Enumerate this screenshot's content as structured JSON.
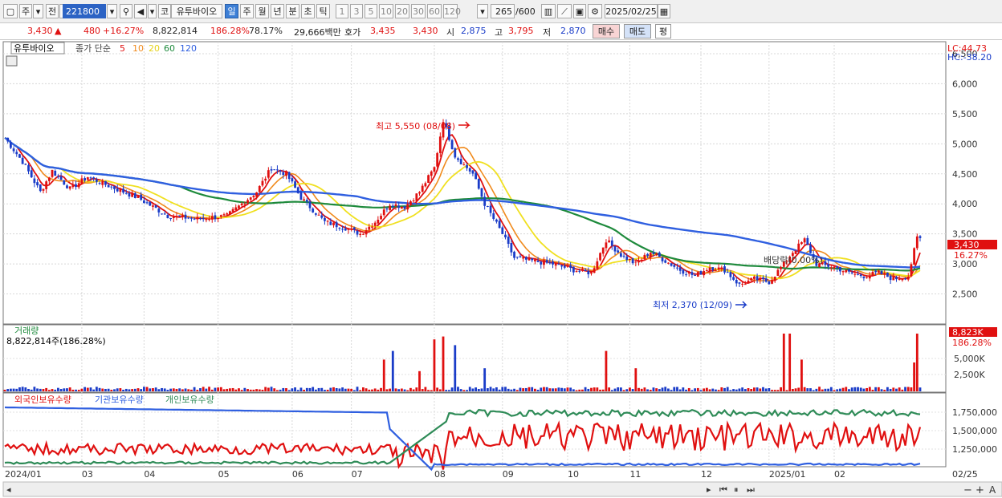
{
  "toolbar": {
    "period_week": "주",
    "prev_label": "전",
    "code": "221800",
    "stock_name_short": "유투바이오",
    "stock_prefix": "코",
    "periods": [
      "일",
      "주",
      "월",
      "년",
      "분",
      "초",
      "틱"
    ],
    "active_period": "일",
    "intervals": [
      "1",
      "3",
      "5",
      "10",
      "20",
      "30",
      "60",
      "120"
    ],
    "count": "265",
    "count_max": "/600",
    "date": "2025/02/25"
  },
  "quote": {
    "price": "3,430",
    "change": "480",
    "change_pct": "+16.27%",
    "volume": "8,822,814",
    "volume_ratio": "186.28%",
    "turnover_rate": "78.17%",
    "amount": "29,666백만",
    "bid_label": "호가",
    "bid": "3,435",
    "ask": "3,430",
    "open_label": "시",
    "open": "2,875",
    "high_label": "고",
    "high": "3,795",
    "low_label": "저",
    "low": "2,870",
    "buy_label": "매수",
    "sell_label": "매도",
    "eval_label": "평"
  },
  "colors": {
    "up": "#e01010",
    "down": "#1a3cc8",
    "ma5": "#e01010",
    "ma10": "#f08a1c",
    "ma20": "#f0e020",
    "ma60": "#1e8a3c",
    "ma120": "#2f5fe0",
    "foreign": "#e01010",
    "institution": "#2f5fe0",
    "individual": "#2e8b57"
  },
  "chart_data": [
    {
      "type": "candlestick",
      "title": "유투바이오",
      "legend": [
        "종가 단순",
        "5",
        "10",
        "20",
        "60",
        "120"
      ],
      "price_axis": [
        "6,500",
        "6,000",
        "5,500",
        "5,000",
        "4,500",
        "4,000",
        "3,500",
        "3,000",
        "2,500"
      ],
      "ylim": [
        2000,
        6700
      ],
      "lc": "LC:44.73",
      "hc": "HC:-38.20",
      "last_price": "3,430",
      "last_pct": "16.27%",
      "annotations": {
        "high": "최고 5,550 (08/08)",
        "low": "최저 2,370 (12/09)",
        "dividend": "배당락(0.00%)"
      },
      "x_labels": [
        "2024/01",
        "03",
        "04",
        "05",
        "06",
        "07",
        "08",
        "09",
        "10",
        "11",
        "12",
        "2025/01",
        "02",
        "02/25"
      ],
      "close_anchors": [
        [
          0,
          5100
        ],
        [
          6,
          4700
        ],
        [
          12,
          4200
        ],
        [
          16,
          4550
        ],
        [
          22,
          4250
        ],
        [
          28,
          4450
        ],
        [
          35,
          4300
        ],
        [
          45,
          4100
        ],
        [
          55,
          3800
        ],
        [
          65,
          3750
        ],
        [
          75,
          3800
        ],
        [
          85,
          4200
        ],
        [
          90,
          4600
        ],
        [
          95,
          4500
        ],
        [
          100,
          4100
        ],
        [
          108,
          3700
        ],
        [
          115,
          3600
        ],
        [
          120,
          3500
        ],
        [
          125,
          3700
        ],
        [
          130,
          4000
        ],
        [
          135,
          3950
        ],
        [
          140,
          4200
        ],
        [
          145,
          4600
        ],
        [
          148,
          5400
        ],
        [
          152,
          4800
        ],
        [
          158,
          4500
        ],
        [
          162,
          4000
        ],
        [
          168,
          3500
        ],
        [
          172,
          3100
        ],
        [
          178,
          3050
        ],
        [
          185,
          3000
        ],
        [
          192,
          2900
        ],
        [
          198,
          2850
        ],
        [
          203,
          3400
        ],
        [
          208,
          3150
        ],
        [
          213,
          3000
        ],
        [
          218,
          3200
        ],
        [
          223,
          3050
        ],
        [
          228,
          2900
        ],
        [
          233,
          2800
        ],
        [
          238,
          2950
        ],
        [
          243,
          2900
        ],
        [
          248,
          2650
        ],
        [
          253,
          2750
        ],
        [
          258,
          2700
        ],
        [
          263,
          3000
        ],
        [
          266,
          3200
        ],
        [
          270,
          3400
        ],
        [
          274,
          3000
        ],
        [
          280,
          2950
        ],
        [
          285,
          2850
        ],
        [
          290,
          2800
        ],
        [
          295,
          2850
        ],
        [
          300,
          2750
        ],
        [
          305,
          2800
        ],
        [
          308,
          3430
        ]
      ]
    },
    {
      "type": "bar",
      "title": "거래량",
      "value_label": "8,822,814주(186.28%)",
      "badge": "8,823K",
      "badge_pct": "186.28%",
      "y_axis": [
        "5,000K",
        "2,500K"
      ]
    },
    {
      "type": "line",
      "series_names": [
        "외국인보유수량",
        "기관보유수량",
        "개인보유수량"
      ],
      "y_axis": [
        "1,750,000",
        "1,500,000",
        "1,250,000"
      ]
    }
  ]
}
